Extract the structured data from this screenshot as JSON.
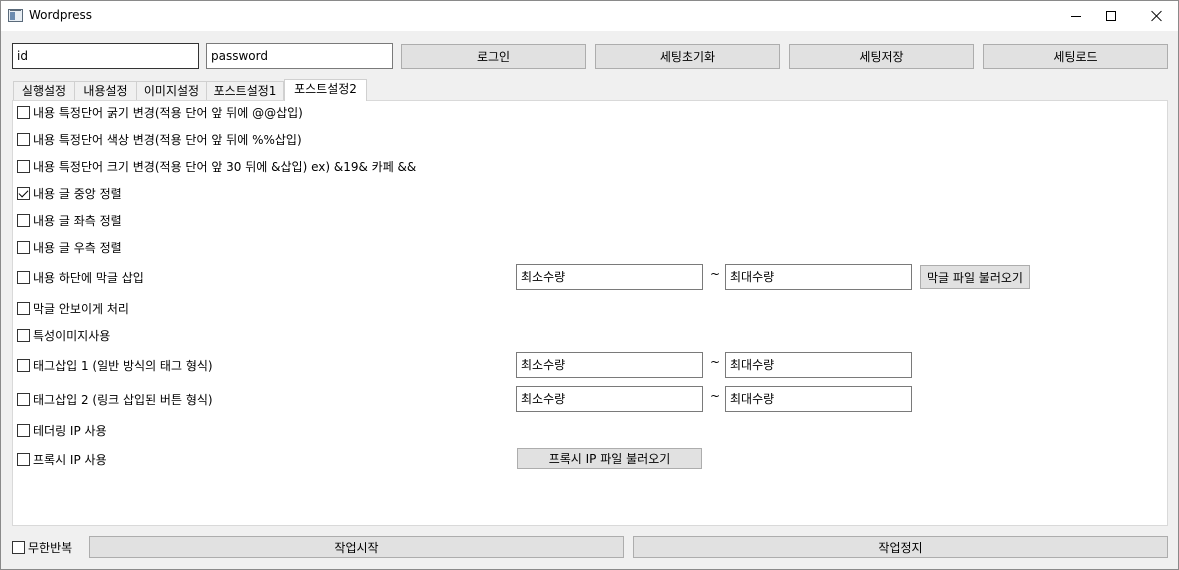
{
  "window": {
    "title": "Wordpress",
    "icon": "app-window-icon"
  },
  "login": {
    "id_placeholder": "id",
    "password_placeholder": "password",
    "login_label": "로그인",
    "reset_label": "세팅초기화",
    "save_label": "세팅저장",
    "load_label": "세팅로드"
  },
  "tabs": [
    {
      "label": "실행설정",
      "active": false
    },
    {
      "label": "내용설정",
      "active": false
    },
    {
      "label": "이미지설정",
      "active": false
    },
    {
      "label": "포스트설정1",
      "active": false
    },
    {
      "label": "포스트설정2",
      "active": true
    }
  ],
  "options": [
    {
      "label": "내용 특정단어 굵기 변경(적용 단어 앞 뒤에 @@삽입)",
      "checked": false
    },
    {
      "label": "내용 특정단어 색상 변경(적용 단어 앞 뒤에 %%삽입)",
      "checked": false
    },
    {
      "label": "내용 특정단어 크기 변경(적용 단어 앞 30 뒤에 &삽입) ex) &19& 카페 &&",
      "checked": false
    },
    {
      "label": "내용 글 중앙 정렬",
      "checked": true
    },
    {
      "label": "내용 글 좌측 정렬",
      "checked": false
    },
    {
      "label": "내용 글 우측 정렬",
      "checked": false
    },
    {
      "label": "내용 하단에 막글 삽입",
      "checked": false
    },
    {
      "label": "막글 안보이게 처리",
      "checked": false
    },
    {
      "label": "특성이미지사용",
      "checked": false
    },
    {
      "label": "태그삽입 1 (일반 방식의 태그 형식)",
      "checked": false
    },
    {
      "label": "태그삽입 2 (링크 삽입된 버튼 형식)",
      "checked": false
    },
    {
      "label": "테더링 IP 사용",
      "checked": false
    },
    {
      "label": "프록시 IP 사용",
      "checked": false
    }
  ],
  "ranges": {
    "min_placeholder": "최소수량",
    "max_placeholder": "최대수량",
    "tilde": "~"
  },
  "file_buttons": {
    "filler_file": "막글 파일 불러오기",
    "proxy_file": "프록시 IP 파일 불러오기"
  },
  "bottom": {
    "loop_label": "무한반복",
    "loop_checked": false,
    "start_label": "작업시작",
    "stop_label": "작업정지"
  }
}
